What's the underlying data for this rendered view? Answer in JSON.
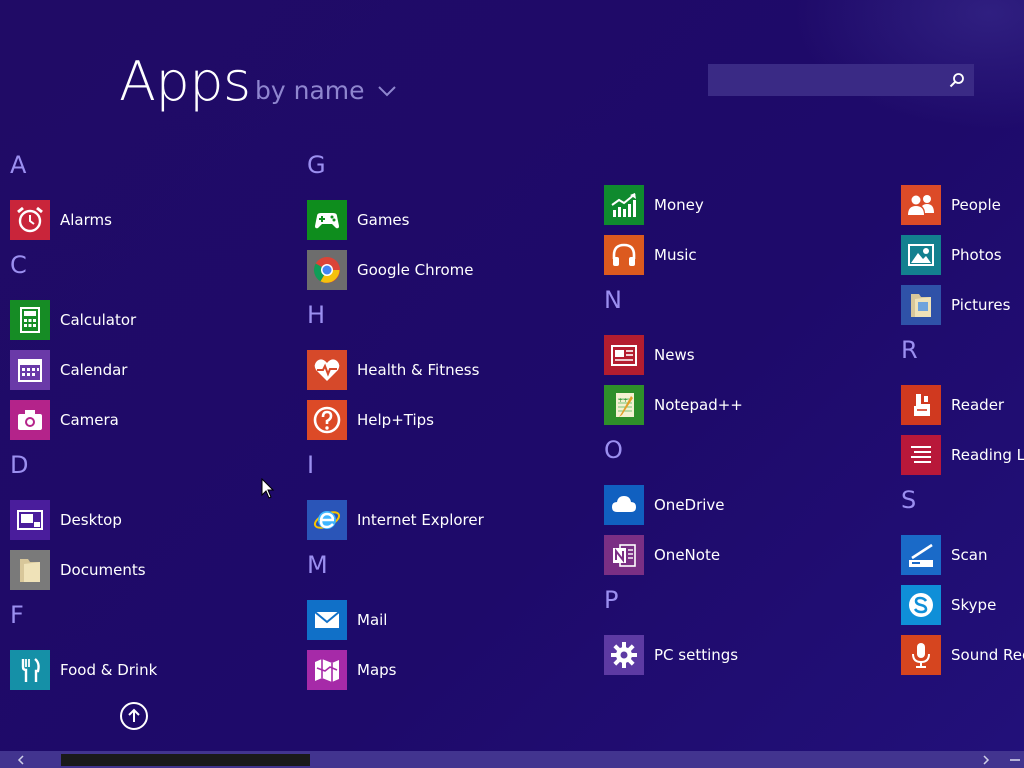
{
  "header": {
    "title": "Apps",
    "sort_label": "by name",
    "search_placeholder": ""
  },
  "colors": {
    "background": "#1f0a68",
    "group_letter": "#9b8ff0",
    "sort_text": "#8f86cf",
    "search_box": "#3a2a85"
  },
  "columns": [
    {
      "groups": [
        {
          "letter": "A",
          "apps": [
            {
              "name": "Alarms",
              "icon": "alarm-clock-icon",
              "color": "#c9253a"
            }
          ]
        },
        {
          "letter": "C",
          "apps": [
            {
              "name": "Calculator",
              "icon": "calculator-icon",
              "color": "#168c25"
            },
            {
              "name": "Calendar",
              "icon": "calendar-icon",
              "color": "#6a3aa8"
            },
            {
              "name": "Camera",
              "icon": "camera-icon",
              "color": "#b4238a"
            }
          ]
        },
        {
          "letter": "D",
          "apps": [
            {
              "name": "Desktop",
              "icon": "desktop-icon",
              "color": "#4a1d9c"
            },
            {
              "name": "Documents",
              "icon": "folder-icon",
              "color": "#7a7a7a"
            }
          ]
        },
        {
          "letter": "F",
          "apps": [
            {
              "name": "Food & Drink",
              "icon": "fork-knife-icon",
              "color": "#1590a7"
            }
          ]
        }
      ]
    },
    {
      "groups": [
        {
          "letter": "G",
          "apps": [
            {
              "name": "Games",
              "icon": "gamepad-icon",
              "color": "#0e8d1d"
            },
            {
              "name": "Google Chrome",
              "icon": "chrome-icon",
              "color": "#6d6d6d"
            }
          ]
        },
        {
          "letter": "H",
          "apps": [
            {
              "name": "Health & Fitness",
              "icon": "heart-pulse-icon",
              "color": "#d6492a"
            },
            {
              "name": "Help+Tips",
              "icon": "question-icon",
              "color": "#dc4a27"
            }
          ]
        },
        {
          "letter": "I",
          "apps": [
            {
              "name": "Internet Explorer",
              "icon": "ie-icon",
              "color": "#2a55b8"
            }
          ]
        },
        {
          "letter": "M",
          "apps": [
            {
              "name": "Mail",
              "icon": "envelope-icon",
              "color": "#1070c8"
            },
            {
              "name": "Maps",
              "icon": "map-icon",
              "color": "#a62aa8"
            }
          ]
        }
      ]
    },
    {
      "groups": [
        {
          "letter": "",
          "apps": [
            {
              "name": "Money",
              "icon": "chart-up-icon",
              "color": "#0f8a2e"
            },
            {
              "name": "Music",
              "icon": "headphones-icon",
              "color": "#dc5a1f"
            }
          ]
        },
        {
          "letter": "N",
          "apps": [
            {
              "name": "News",
              "icon": "newspaper-icon",
              "color": "#b41d2f"
            },
            {
              "name": "Notepad++",
              "icon": "notepad-icon",
              "color": "#2e8f2a"
            }
          ]
        },
        {
          "letter": "O",
          "apps": [
            {
              "name": "OneDrive",
              "icon": "cloud-icon",
              "color": "#1060c0"
            },
            {
              "name": "OneNote",
              "icon": "onenote-icon",
              "color": "#7a2f84"
            }
          ]
        },
        {
          "letter": "P",
          "apps": [
            {
              "name": "PC settings",
              "icon": "gear-icon",
              "color": "#5d3aa3"
            }
          ]
        }
      ]
    },
    {
      "groups": [
        {
          "letter": "",
          "apps": [
            {
              "name": "People",
              "icon": "people-icon",
              "color": "#dc4b28"
            },
            {
              "name": "Photos",
              "icon": "photo-icon",
              "color": "#13808f"
            },
            {
              "name": "Pictures",
              "icon": "folder-pictures-icon",
              "color": "#2f52a8"
            }
          ]
        },
        {
          "letter": "R",
          "apps": [
            {
              "name": "Reader",
              "icon": "reader-icon",
              "color": "#d0391f"
            },
            {
              "name": "Reading Lis",
              "icon": "reading-list-icon",
              "color": "#b8183a"
            }
          ]
        },
        {
          "letter": "S",
          "apps": [
            {
              "name": "Scan",
              "icon": "scanner-icon",
              "color": "#1a6ac8"
            },
            {
              "name": "Skype",
              "icon": "skype-icon",
              "color": "#0f8fd8"
            },
            {
              "name": "Sound Reco",
              "icon": "microphone-icon",
              "color": "#d6451f"
            }
          ]
        }
      ]
    }
  ]
}
